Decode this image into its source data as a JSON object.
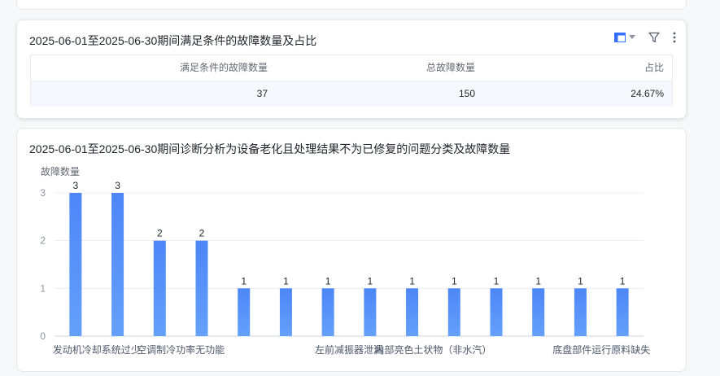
{
  "table_card": {
    "title": "2025-06-01至2025-06-30期间满足条件的故障数量及占比",
    "columns": [
      "满足条件的故障数量",
      "总故障数量",
      "占比"
    ],
    "row": [
      "37",
      "150",
      "24.67%"
    ],
    "icons": [
      "chart-type-icon",
      "filter-icon",
      "more-icon"
    ]
  },
  "chart_card": {
    "title": "2025-06-01至2025-06-30期间诊断分析为设备老化且处理结果不为已修复的问题分类及故障数量"
  },
  "chart_data": {
    "type": "bar",
    "ylabel": "故障数量",
    "ylim": [
      0,
      3
    ],
    "yticks": [
      0,
      1,
      2,
      3
    ],
    "grid": true,
    "bar_color": "#4d86f7",
    "categories": [
      "发动机冷却系统过少",
      "",
      "空调制冷功率无功能",
      "",
      "",
      "",
      "左前减振器泄漏",
      "",
      "内部亮色土状物（非水汽）",
      "",
      "",
      "",
      "底盘部件运行原料缺失",
      ""
    ],
    "visible_tick_labels": [
      "发动机冷却系统过少",
      "空调制冷功率无功能",
      "左前减振器泄漏",
      "内部亮色土状物（非水汽）",
      "底盘部件运行原料缺失"
    ],
    "values": [
      3,
      3,
      2,
      2,
      1,
      1,
      1,
      1,
      1,
      1,
      1,
      1,
      1,
      1
    ]
  }
}
